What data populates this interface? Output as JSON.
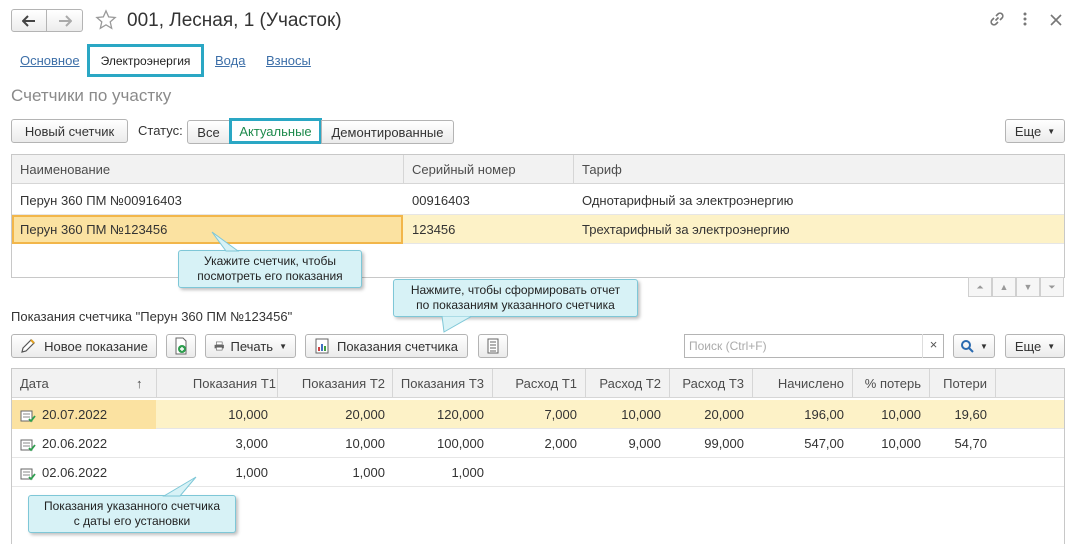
{
  "window": {
    "title": "001, Лесная, 1 (Участок)"
  },
  "tabs": [
    {
      "label": "Основное",
      "active": false
    },
    {
      "label": "Электроэнергия",
      "active": true
    },
    {
      "label": "Вода",
      "active": false
    },
    {
      "label": "Взносы",
      "active": false
    }
  ],
  "meters": {
    "section_title": "Счетчики по участку",
    "new_button": "Новый счетчик",
    "status_label": "Статус:",
    "status_options": [
      "Все",
      "Актуальные",
      "Демонтированные"
    ],
    "status_selected": "Актуальные",
    "more_button": "Еще",
    "columns": [
      "Наименование",
      "Серийный номер",
      "Тариф"
    ],
    "rows": [
      {
        "name": "Перун 360 ПМ №00916403",
        "serial": "00916403",
        "tariff": "Однотарифный за электроэнергию",
        "selected": false
      },
      {
        "name": "Перун 360 ПМ №123456",
        "serial": "123456",
        "tariff": "Трехтарифный за электроэнергию",
        "selected": true
      }
    ]
  },
  "readings": {
    "caption": "Показания счетчика \"Перун 360 ПМ №123456\"",
    "new_button": "Новое показание",
    "print_button": "Печать",
    "report_button": "Показания счетчика",
    "search_placeholder": "Поиск (Ctrl+F)",
    "search_clear": "×",
    "more_button": "Еще",
    "sort_indicator": "↑",
    "columns": [
      "Дата",
      "Показания Т1",
      "Показания Т2",
      "Показания Т3",
      "Расход Т1",
      "Расход Т2",
      "Расход Т3",
      "Начислено",
      "% потерь",
      "Потери"
    ],
    "rows": [
      {
        "date": "20.07.2022",
        "t1": "10,000",
        "t2": "20,000",
        "t3": "120,000",
        "r1": "7,000",
        "r2": "10,000",
        "r3": "20,000",
        "charged": "196,00",
        "loss_pct": "10,000",
        "loss": "19,60",
        "selected": true
      },
      {
        "date": "20.06.2022",
        "t1": "3,000",
        "t2": "10,000",
        "t3": "100,000",
        "r1": "2,000",
        "r2": "9,000",
        "r3": "99,000",
        "charged": "547,00",
        "loss_pct": "10,000",
        "loss": "54,70",
        "selected": false
      },
      {
        "date": "02.06.2022",
        "t1": "1,000",
        "t2": "1,000",
        "t3": "1,000",
        "r1": "",
        "r2": "",
        "r3": "",
        "charged": "",
        "loss_pct": "",
        "loss": "",
        "selected": false
      }
    ]
  },
  "tooltips": {
    "select_meter": [
      "Укажите счетчик, чтобы",
      "посмотреть его показания"
    ],
    "report": [
      "Нажмите, чтобы сформировать отчет",
      "по показаниям указанного счетчика"
    ],
    "history": [
      "Показания указанного счетчика",
      "с даты его установки"
    ]
  },
  "colors": {
    "accent_frame": "#2aa7c4",
    "selected_row": "#fdf2c7",
    "link": "#3d6fa8",
    "active_status_text": "#1e8a4c"
  }
}
